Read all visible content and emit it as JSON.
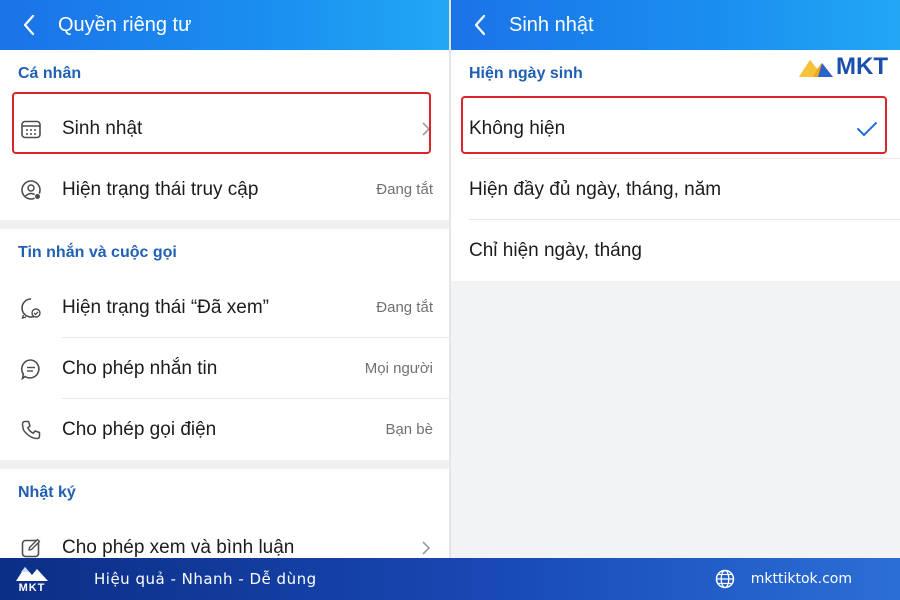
{
  "left": {
    "header_title": "Quyền riêng tư",
    "sections": [
      {
        "title": "Cá nhân",
        "rows": [
          {
            "label": "Sinh nhật",
            "value": ""
          },
          {
            "label": "Hiện trạng thái truy cập",
            "value": "Đang tắt"
          }
        ]
      },
      {
        "title": "Tin nhắn và cuộc gọi",
        "rows": [
          {
            "label": "Hiện trạng thái “Đã xem”",
            "value": "Đang tắt"
          },
          {
            "label": "Cho phép nhắn tin",
            "value": "Mọi người"
          },
          {
            "label": "Cho phép gọi điện",
            "value": "Bạn bè"
          }
        ]
      },
      {
        "title": "Nhật ký",
        "rows": [
          {
            "label": "Cho phép xem và bình luận",
            "value": ""
          }
        ]
      }
    ]
  },
  "right": {
    "header_title": "Sinh nhật",
    "section_title": "Hiện ngày sinh",
    "options": [
      {
        "label": "Không hiện",
        "selected": true
      },
      {
        "label": "Hiện đầy đủ ngày, tháng, năm",
        "selected": false
      },
      {
        "label": "Chỉ hiện ngày, tháng",
        "selected": false
      }
    ],
    "watermark": "MKT"
  },
  "footer": {
    "logo_text": "MKT",
    "slogan": "Hiệu quả - Nhanh - Dễ dùng",
    "website": "mkttiktok.com"
  },
  "colors": {
    "header_gradient_start": "#1b73e8",
    "section_title": "#1f5fb4",
    "highlight_border": "#d9242b",
    "check": "#1f6fe0",
    "footer_bg": "#1849b5"
  },
  "icons": [
    "back-arrow-icon",
    "calendar-icon",
    "user-status-icon",
    "seen-message-icon",
    "chat-bubble-icon",
    "phone-icon",
    "edit-icon",
    "chevron-right-icon",
    "checkmark-icon",
    "globe-icon"
  ]
}
